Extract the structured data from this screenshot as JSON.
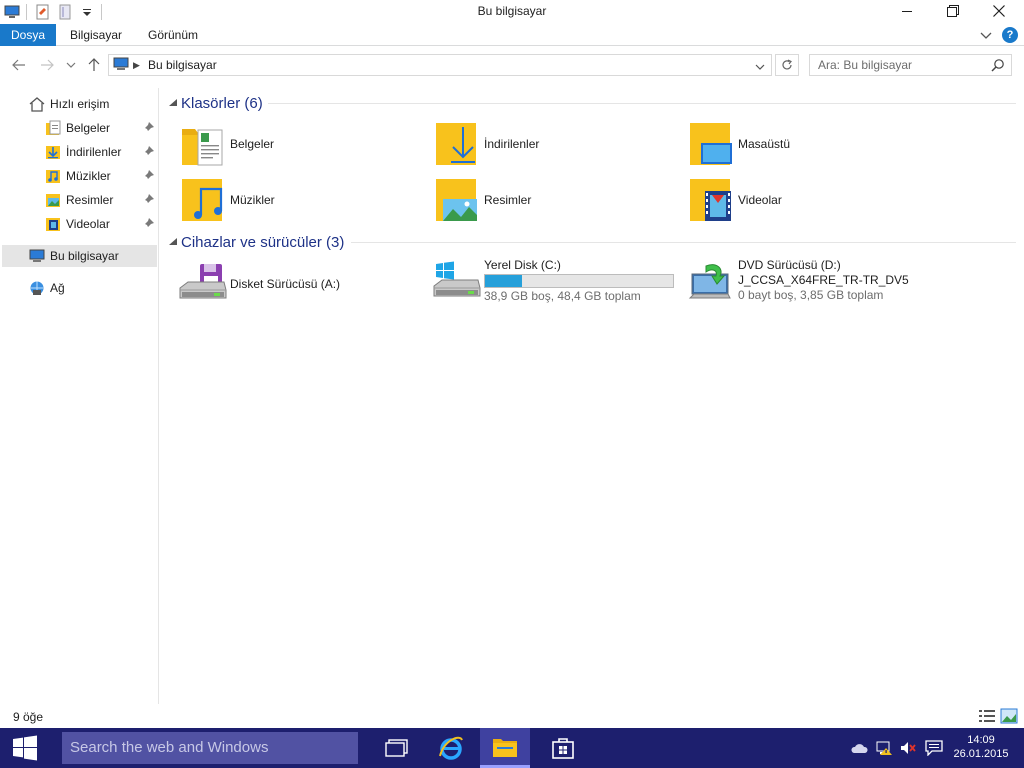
{
  "window": {
    "title": "Bu bilgisayar"
  },
  "ribbon": {
    "tabs": [
      {
        "label": "Dosya"
      },
      {
        "label": "Bilgisayar"
      },
      {
        "label": "Görünüm"
      }
    ],
    "help_label": "?"
  },
  "address": {
    "path": "Bu bilgisayar",
    "search_placeholder": "Ara: Bu bilgisayar"
  },
  "nav": {
    "quick_access": "Hızlı erişim",
    "pinned": [
      {
        "label": "Belgeler"
      },
      {
        "label": "İndirilenler"
      },
      {
        "label": "Müzikler"
      },
      {
        "label": "Resimler"
      },
      {
        "label": "Videolar"
      }
    ],
    "this_pc": "Bu bilgisayar",
    "network": "Ağ"
  },
  "folders_group": {
    "title": "Klasörler (6)",
    "items": [
      {
        "label": "Belgeler",
        "icon": "documents-folder-icon"
      },
      {
        "label": "İndirilenler",
        "icon": "downloads-folder-icon"
      },
      {
        "label": "Masaüstü",
        "icon": "desktop-folder-icon"
      },
      {
        "label": "Müzikler",
        "icon": "music-folder-icon"
      },
      {
        "label": "Resimler",
        "icon": "pictures-folder-icon"
      },
      {
        "label": "Videolar",
        "icon": "videos-folder-icon"
      }
    ]
  },
  "devices_group": {
    "title": "Cihazlar ve sürücüler (3)",
    "floppy": {
      "label": "Disket Sürücüsü (A:)"
    },
    "local_disk": {
      "label": "Yerel Disk (C:)",
      "usage": "38,9 GB boş, 48,4 GB toplam",
      "used_fraction": 0.196
    },
    "dvd": {
      "label": "DVD Sürücüsü (D:)",
      "volume": "J_CCSA_X64FRE_TR-TR_DV5",
      "usage": "0 bayt boş, 3,85 GB toplam"
    }
  },
  "status": {
    "item_count": "9 öğe"
  },
  "taskbar": {
    "search_placeholder": "Search the web and Windows",
    "time": "14:09",
    "date": "26.01.2015"
  },
  "colors": {
    "accent": "#1979ca",
    "group_header": "#1e3287",
    "taskbar": "#1d1f6e",
    "disk_bar": "#26a0da",
    "folder": "#f8c21c"
  }
}
